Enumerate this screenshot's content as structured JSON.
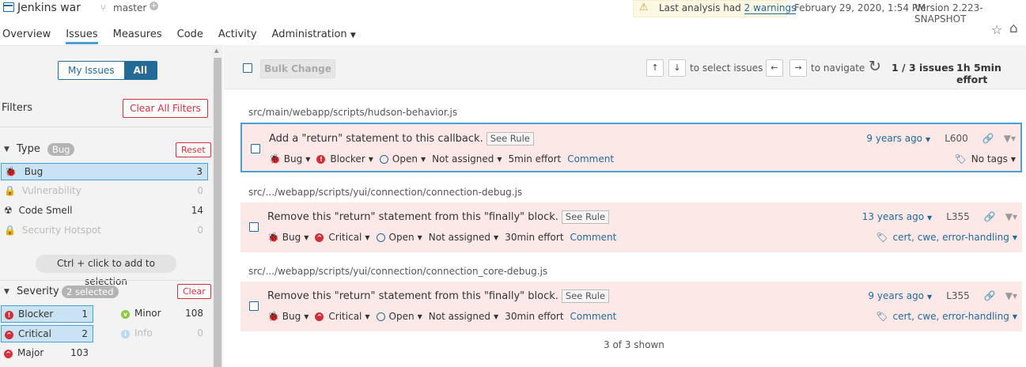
{
  "header": {
    "project_name": "Jenkins war",
    "branch": "master",
    "warning_prefix": "Last analysis had",
    "warning_link": "2 warnings",
    "analysis_date": "February 29, 2020, 1:54 PM",
    "version": "Version 2.223-SNAPSHOT"
  },
  "nav": {
    "tabs": [
      "Overview",
      "Issues",
      "Measures",
      "Code",
      "Activity",
      "Administration"
    ],
    "active": "Issues"
  },
  "sidebar": {
    "my_issues": "My Issues",
    "all": "All",
    "filters_title": "Filters",
    "clear_all": "Clear All Filters",
    "type": {
      "title": "Type",
      "pill": "Bug",
      "reset": "Reset",
      "items": [
        {
          "label": "Bug",
          "count": "3"
        },
        {
          "label": "Vulnerability",
          "count": "0"
        },
        {
          "label": "Code Smell",
          "count": "14"
        },
        {
          "label": "Security Hotspot",
          "count": "0"
        }
      ]
    },
    "ctrl_hint": "Ctrl + click to add to selection",
    "severity": {
      "title": "Severity",
      "pill": "2 selected",
      "clear": "Clear",
      "items": [
        {
          "label": "Blocker",
          "count": "1"
        },
        {
          "label": "Critical",
          "count": "2"
        },
        {
          "label": "Major",
          "count": "103"
        },
        {
          "label": "Minor",
          "count": "108"
        },
        {
          "label": "Info",
          "count": "0"
        }
      ]
    }
  },
  "toolbar": {
    "bulk_change": "Bulk Change",
    "select_hint": "to select issues",
    "navigate_hint": "to navigate",
    "counter": "1 / 3 issues",
    "effort": "1h 5min effort"
  },
  "issues": [
    {
      "path": "src/main/webapp/scripts/hudson-behavior.js",
      "title": "Add a \"return\" statement to this callback.",
      "see_rule": "See Rule",
      "type": "Bug",
      "severity": "Blocker",
      "status": "Open",
      "assignee": "Not assigned",
      "effort": "5min effort",
      "comment": "Comment",
      "age": "9 years ago",
      "line": "L600",
      "tags": "No tags"
    },
    {
      "path": "src/.../webapp/scripts/yui/connection/connection-debug.js",
      "title": "Remove this \"return\" statement from this \"finally\" block.",
      "see_rule": "See Rule",
      "type": "Bug",
      "severity": "Critical",
      "status": "Open",
      "assignee": "Not assigned",
      "effort": "30min effort",
      "comment": "Comment",
      "age": "13 years ago",
      "line": "L355",
      "tags": "cert, cwe, error-handling"
    },
    {
      "path": "src/.../webapp/scripts/yui/connection/connection_core-debug.js",
      "title": "Remove this \"return\" statement from this \"finally\" block.",
      "see_rule": "See Rule",
      "type": "Bug",
      "severity": "Critical",
      "status": "Open",
      "assignee": "Not assigned",
      "effort": "30min effort",
      "comment": "Comment",
      "age": "9 years ago",
      "line": "L355",
      "tags": "cert, cwe, error-handling"
    }
  ],
  "footer": {
    "shown": "3 of 3 shown"
  },
  "colors": {
    "accent": "#236a97",
    "danger": "#d02f3a",
    "issue_bg": "#fde8e8",
    "selected_facet": "#cae3f2"
  }
}
